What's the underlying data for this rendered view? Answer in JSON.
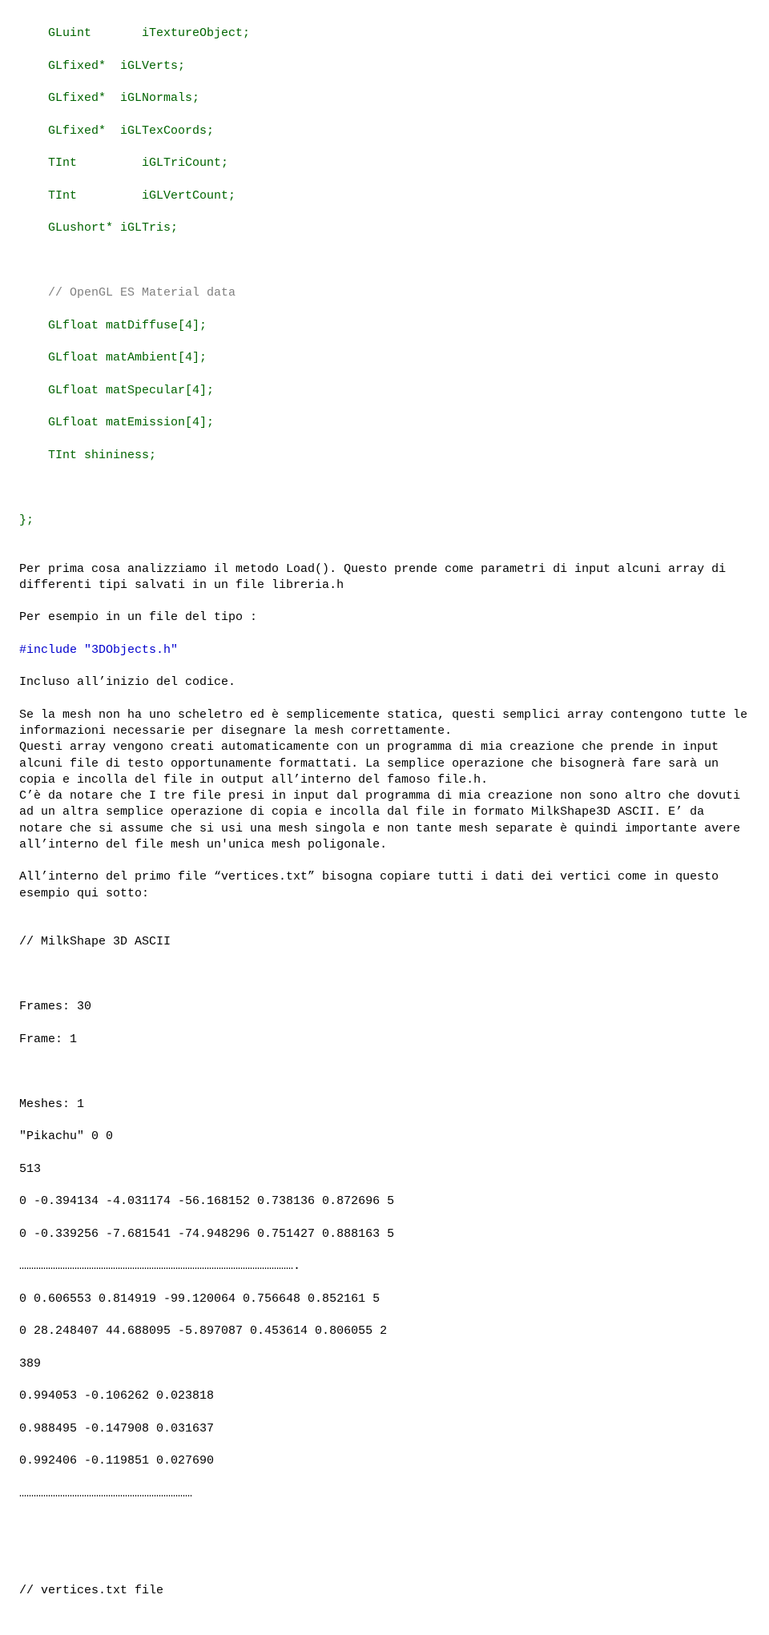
{
  "code1": {
    "l1": "    GLuint       iTextureObject;",
    "l2": "    GLfixed*  iGLVerts;",
    "l3": "    GLfixed*  iGLNormals;",
    "l4": "    GLfixed*  iGLTexCoords;",
    "l5": "    TInt         iGLTriCount;",
    "l6": "    TInt         iGLVertCount;",
    "l7": "    GLushort* iGLTris;",
    "c1": "    // OpenGL ES Material data",
    "l8": "    GLfloat matDiffuse[4];",
    "l9": "    GLfloat matAmbient[4];",
    "l10": "    GLfloat matSpecular[4];",
    "l11": "    GLfloat matEmission[4];",
    "l12": "    TInt shininess;",
    "end": "};"
  },
  "para1": "Per prima cosa analizziamo il metodo Load(). Questo prende come parametri di input alcuni array di differenti tipi salvati in un file libreria.h",
  "para2": "Per esempio in un file del tipo :",
  "include": "#include \"3DObjects.h\"",
  "para3": "Incluso all’inizio del codice.",
  "para4": "Se la mesh non ha uno scheletro ed è semplicemente statica, questi semplici array contengono tutte le informazioni necessarie per disegnare la mesh correttamente.",
  "para5": "Questi array vengono creati automaticamente con un programma di mia creazione che prende in input alcuni file di testo opportunamente formattati. La semplice operazione che bisognerà fare sarà un copia e incolla del file in output all’interno del famoso file.h.",
  "para6": "C’è da notare che I tre file presi in input dal programma di mia creazione non sono altro che dovuti ad un altra semplice operazione di copia e incolla dal file in formato MilkShape3D ASCII. E’ da notare che si assume che si usi una mesh singola e non tante mesh separate è quindi importante avere all’interno del file mesh un'unica mesh poligonale.",
  "para7": "All’interno del primo file “vertices.txt” bisogna copiare tutti i dati dei vertici come in questo esempio qui sotto:",
  "code2": {
    "l1": "// MilkShape 3D ASCII",
    "l2": "Frames: 30",
    "l3": "Frame: 1",
    "l4": "Meshes: 1",
    "l5": "\"Pikachu\" 0 0",
    "l6": "513",
    "l7": "0 -0.394134 -4.031174 -56.168152 0.738136 0.872696 5",
    "l8": "0 -0.339256 -7.681541 -74.948296 0.751427 0.888163 5",
    "dots1": "…………………………………………………………………………………………………….",
    "l9": "0 0.606553 0.814919 -99.120064 0.756648 0.852161 5",
    "l10": "0 28.248407 44.688095 -5.897087 0.453614 0.806055 2",
    "l11": "389",
    "l12": "0.994053 -0.106262 0.023818",
    "l13": "0.988495 -0.147908 0.031637",
    "l14": "0.992406 -0.119851 0.027690",
    "dots2": "………………………………………………………………",
    "l15": "// vertices.txt file"
  }
}
